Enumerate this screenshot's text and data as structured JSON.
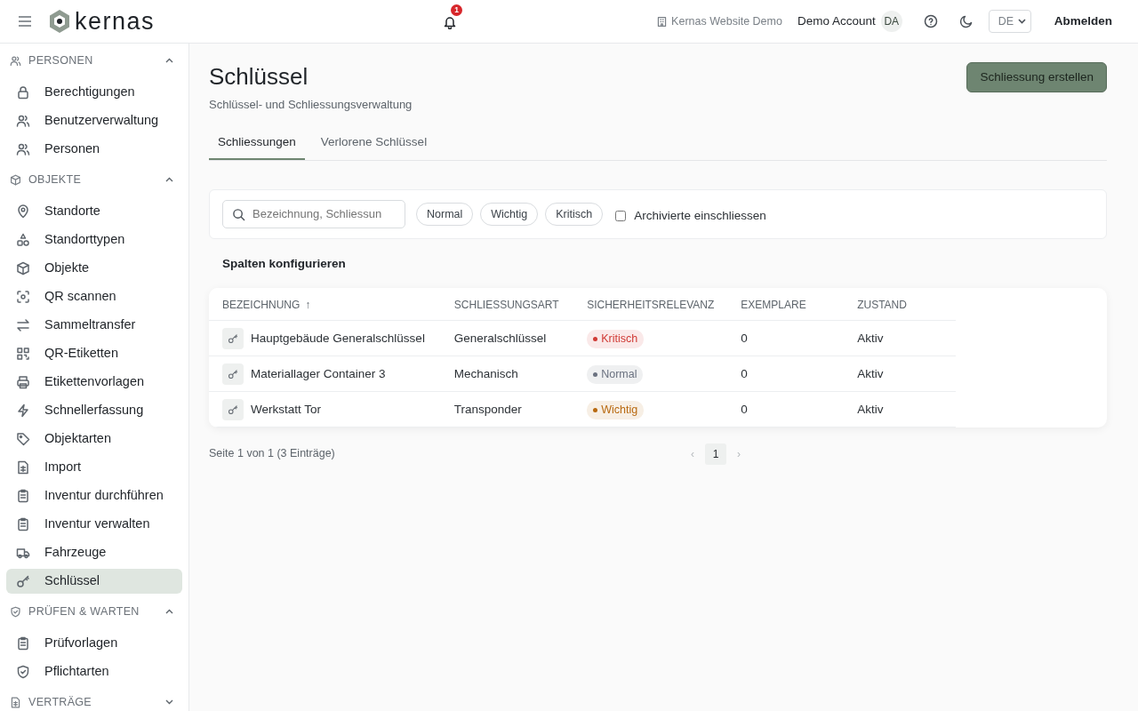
{
  "header": {
    "brand": "kernas",
    "notifications": {
      "count": "1"
    },
    "tenant": "Kernas Website Demo",
    "account": "Demo Account",
    "avatar": "DA",
    "language": "DE",
    "logout": "Abmelden"
  },
  "sidebar": {
    "sections": [
      {
        "title": "PERSONEN",
        "kind": "users",
        "expanded": true,
        "items": [
          {
            "label": "Berechtigungen",
            "kind": "lock",
            "selected": false
          },
          {
            "label": "Benutzerverwaltung",
            "kind": "users",
            "selected": false
          },
          {
            "label": "Personen",
            "kind": "users",
            "selected": false
          }
        ]
      },
      {
        "title": "OBJEKTE",
        "kind": "box",
        "expanded": true,
        "items": [
          {
            "label": "Standorte",
            "kind": "pin",
            "selected": false
          },
          {
            "label": "Standorttypen",
            "kind": "shapes",
            "selected": false
          },
          {
            "label": "Objekte",
            "kind": "box",
            "selected": false
          },
          {
            "label": "QR scannen",
            "kind": "scan",
            "selected": false
          },
          {
            "label": "Sammeltransfer",
            "kind": "arrows",
            "selected": false
          },
          {
            "label": "QR-Etiketten",
            "kind": "qr",
            "selected": false
          },
          {
            "label": "Etikettenvorlagen",
            "kind": "printer",
            "selected": false
          },
          {
            "label": "Schnellerfassung",
            "kind": "bolt",
            "selected": false
          },
          {
            "label": "Objektarten",
            "kind": "tag",
            "selected": false
          },
          {
            "label": "Import",
            "kind": "sheet",
            "selected": false
          },
          {
            "label": "Inventur durchführen",
            "kind": "clipboard",
            "selected": false
          },
          {
            "label": "Inventur verwalten",
            "kind": "clipboard",
            "selected": false
          },
          {
            "label": "Fahrzeuge",
            "kind": "truck",
            "selected": false
          },
          {
            "label": "Schlüssel",
            "kind": "key",
            "selected": true
          }
        ]
      },
      {
        "title": "PRÜFEN & WARTEN",
        "kind": "shield",
        "expanded": true,
        "items": [
          {
            "label": "Prüfvorlagen",
            "kind": "clipboard",
            "selected": false
          },
          {
            "label": "Pflichtarten",
            "kind": "shield",
            "selected": false
          }
        ]
      },
      {
        "title": "VERTRÄGE",
        "kind": "sheet",
        "expanded": false
      }
    ]
  },
  "page": {
    "title": "Schlüssel",
    "subtitle": "Schlüssel- und Schliessungsverwaltung",
    "primary_button": "Schliessung erstellen",
    "tabs": [
      {
        "label": "Schliessungen",
        "selected": true
      },
      {
        "label": "Verlorene Schlüssel",
        "selected": false
      }
    ],
    "search": {
      "placeholder": "Bezeichnung, Schliessun"
    },
    "filters": [
      {
        "label": "Normal",
        "selected": false
      },
      {
        "label": "Wichtig",
        "selected": false
      },
      {
        "label": "Kritisch",
        "selected": false
      }
    ],
    "archived": {
      "label": "Archivierte einschliessen",
      "checked": false
    },
    "configure_columns": "Spalten konfigurieren",
    "table": {
      "columns": [
        {
          "label": "BEZEICHNUNG",
          "sort": "↑"
        },
        {
          "label": "SCHLIESSUNGSART"
        },
        {
          "label": "SICHERHEITSRELEVANZ"
        },
        {
          "label": "EXEMPLARE"
        },
        {
          "label": "ZUSTAND"
        }
      ],
      "rows": [
        {
          "name": "Hauptgebäude Generalschlüssel",
          "type": "Generalschlüssel",
          "relevance": {
            "label": "Kritisch",
            "color": "#d03a35"
          },
          "copies": "0",
          "state": "Aktiv"
        },
        {
          "name": "Materiallager Container 3",
          "type": "Mechanisch",
          "relevance": {
            "label": "Normal",
            "color": "#6b7280"
          },
          "copies": "0",
          "state": "Aktiv"
        },
        {
          "name": "Werkstatt Tor",
          "type": "Transponder",
          "relevance": {
            "label": "Wichtig",
            "color": "#b8690f"
          },
          "copies": "0",
          "state": "Aktiv"
        }
      ]
    },
    "pagination": {
      "summary": "Seite 1 von 1 (3 Einträge)",
      "prev": "‹",
      "pages": [
        {
          "label": "1",
          "selected": true
        }
      ],
      "next": "›"
    }
  }
}
